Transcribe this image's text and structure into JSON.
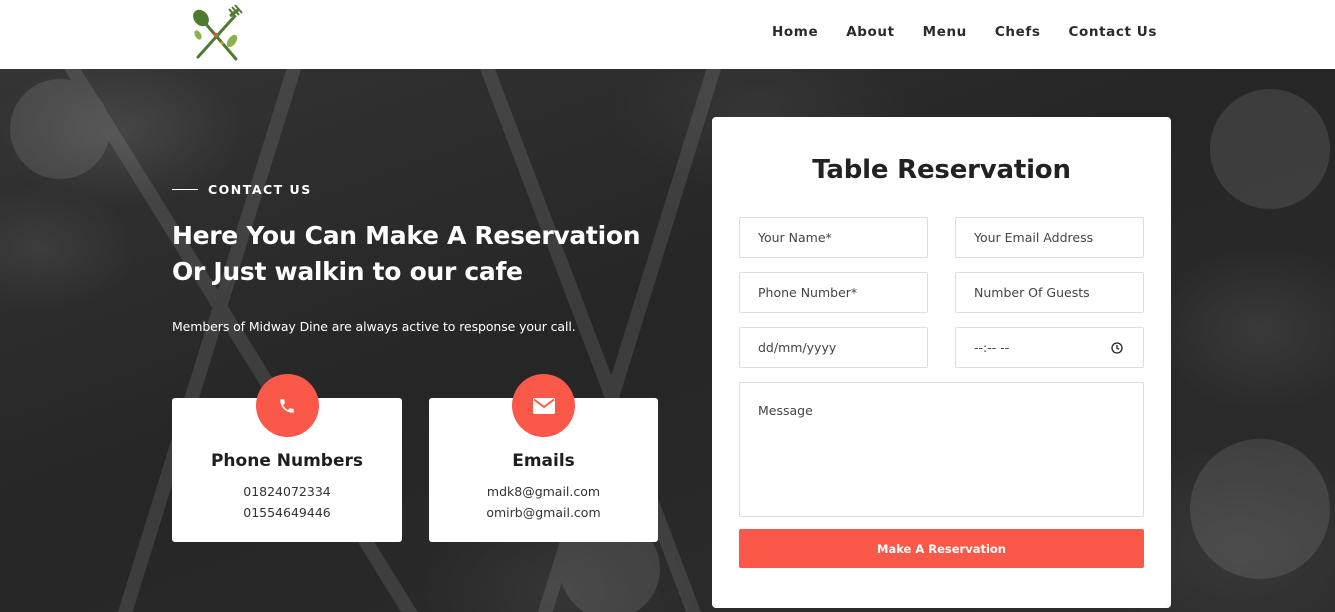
{
  "header": {
    "logo_icon": "fork-spoon-leaf-icon",
    "nav": [
      {
        "label": "Home"
      },
      {
        "label": "About"
      },
      {
        "label": "Menu"
      },
      {
        "label": "Chefs"
      },
      {
        "label": "Contact Us"
      }
    ]
  },
  "contact": {
    "eyebrow": "CONTACT US",
    "headline_line1": "Here You Can Make A Reservation",
    "headline_line2": "Or Just walkin to our cafe",
    "subtext": "Members of Midway Dine are always active to response your call.",
    "cards": {
      "phone": {
        "icon": "phone-icon",
        "title": "Phone Numbers",
        "lines": [
          "01824072334",
          "01554649446"
        ]
      },
      "email": {
        "icon": "envelope-icon",
        "title": "Emails",
        "lines": [
          "mdk8@gmail.com",
          "omirb@gmail.com"
        ]
      }
    }
  },
  "reservation": {
    "title": "Table Reservation",
    "name_placeholder": "Your Name*",
    "email_placeholder": "Your Email Address",
    "phone_placeholder": "Phone Number*",
    "guests_placeholder": "Number Of Guests",
    "date_placeholder": "dd/mm/yyyy",
    "time_placeholder": "--:-- --",
    "message_placeholder": "Message",
    "submit_label": "Make A Reservation"
  },
  "colors": {
    "accent": "#fa5848",
    "logo_green": "#4f7a32",
    "dark_bg": "#2a2a2a"
  }
}
